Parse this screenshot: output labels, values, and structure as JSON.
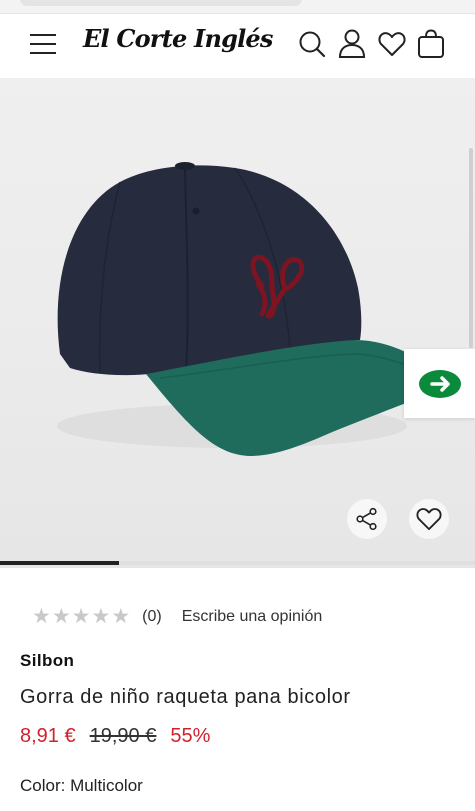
{
  "header": {
    "logo_text": "El Corte Inglés"
  },
  "gallery": {
    "image_alt": "Gorra de niño raqueta pana bicolor",
    "current_image_progress": 0.25
  },
  "product": {
    "rating": {
      "stars_total": 5,
      "stars_filled": 0,
      "count_label": "(0)",
      "write_review_label": "Escribe una opinión"
    },
    "brand": "Silbon",
    "title": "Gorra de niño raqueta pana bicolor",
    "price_current": "8,91 €",
    "price_original": "19,90 €",
    "discount": "55%",
    "color_label": "Color: Multicolor"
  },
  "colors": {
    "accent_red": "#d3212c",
    "cap_navy": "#262c3d",
    "cap_green": "#1f6b5c",
    "embroidery": "#7c1422",
    "widget_green": "#0a8a3a"
  },
  "icons": {
    "menu": "hamburger-menu-icon",
    "search": "search-icon",
    "account": "user-icon",
    "wishlist": "heart-icon",
    "cart": "shopping-bag-icon",
    "share": "share-icon",
    "favorite": "heart-icon",
    "widget": "play-arrow-icon"
  }
}
